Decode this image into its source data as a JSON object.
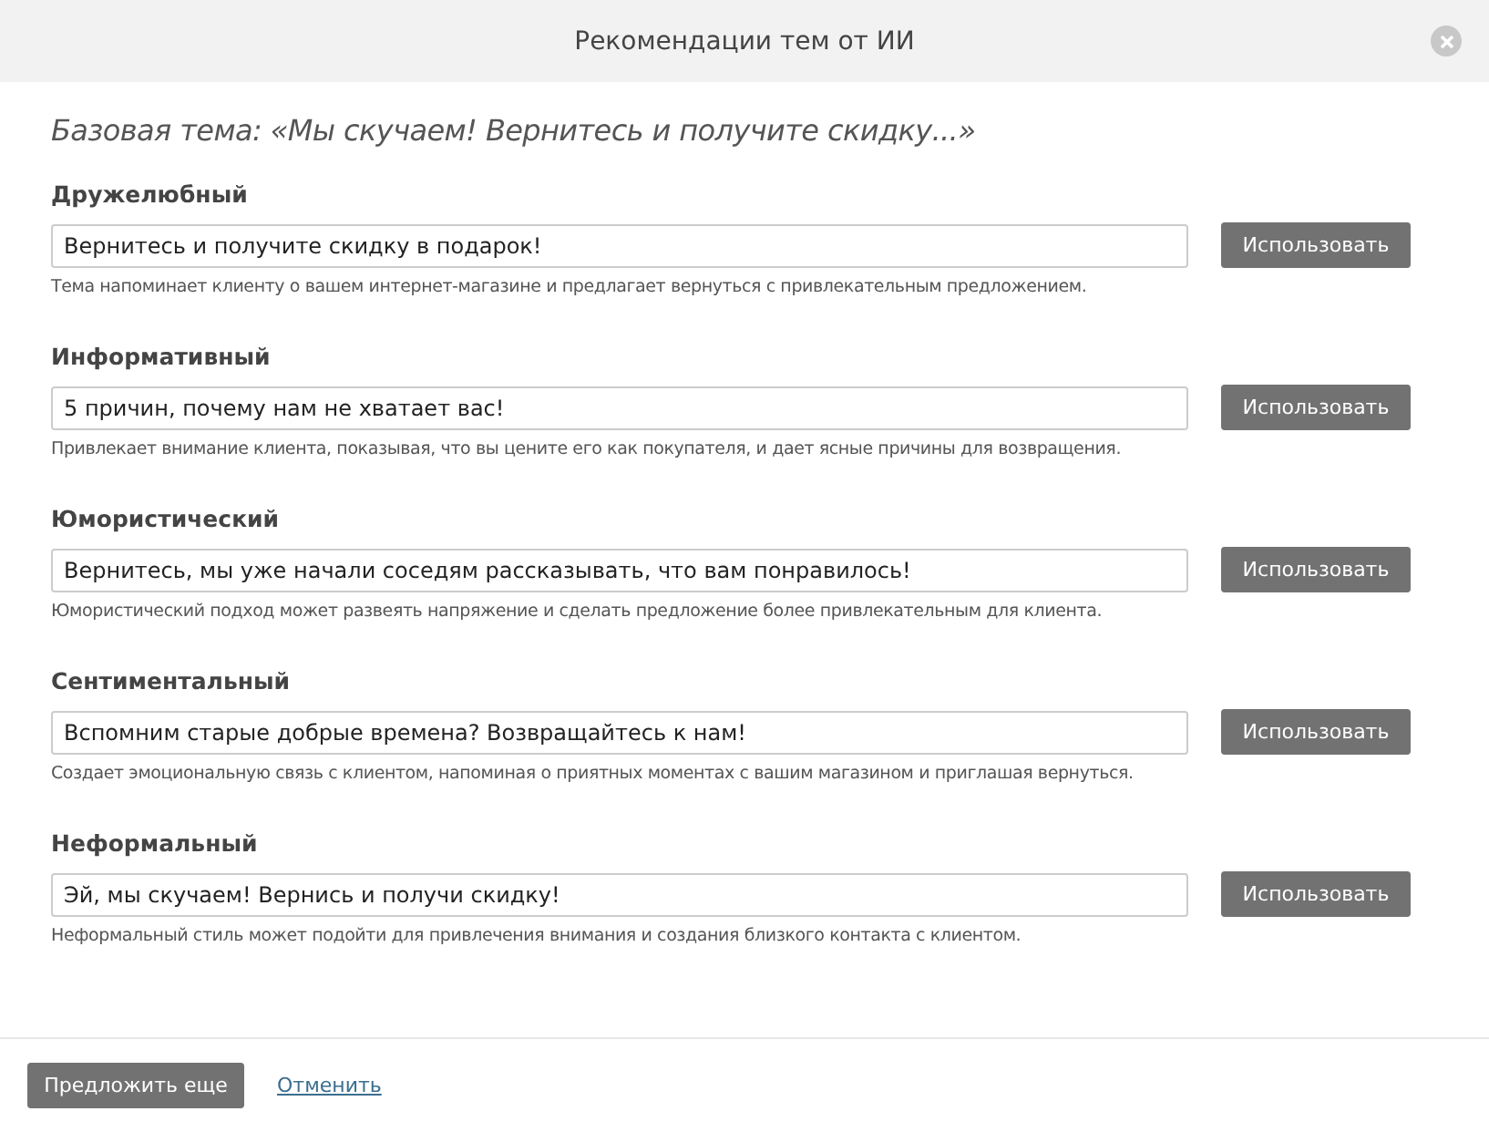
{
  "dialog": {
    "title": "Рекомендации тем от ИИ"
  },
  "base_topic": "Базовая тема: «Мы скучаем! Вернитесь и получите скидку...»",
  "suggestions": [
    {
      "style": "Дружелюбный",
      "value": "Вернитесь и получите скидку в подарок!",
      "button": "Использовать",
      "hint": "Тема напоминает клиенту о вашем интернет-магазине и предлагает вернуться с привлекательным предложением."
    },
    {
      "style": "Информативный",
      "value": "5 причин, почему нам не хватает вас!",
      "button": "Использовать",
      "hint": "Привлекает внимание клиента, показывая, что вы цените его как покупателя, и дает ясные причины для возвращения."
    },
    {
      "style": "Юмористический",
      "value": "Вернитесь, мы уже начали соседям рассказывать, что вам понравилось!",
      "button": "Использовать",
      "hint": "Юмористический подход может развеять напряжение и сделать предложение более привлекательным для клиента."
    },
    {
      "style": "Сентиментальный",
      "value": "Вспомним старые добрые времена? Возвращайтесь к нам!",
      "button": "Использовать",
      "hint": "Создает эмоциональную связь с клиентом, напоминая о приятных моментах с вашим магазином и приглашая вернуться."
    },
    {
      "style": "Неформальный",
      "value": "Эй, мы скучаем! Вернись и получи скидку!",
      "button": "Использовать",
      "hint": "Неформальный стиль может подойти для привлечения внимания и создания близкого контакта с клиентом."
    }
  ],
  "footer": {
    "primary": "Предложить еще",
    "cancel": "Отменить"
  }
}
